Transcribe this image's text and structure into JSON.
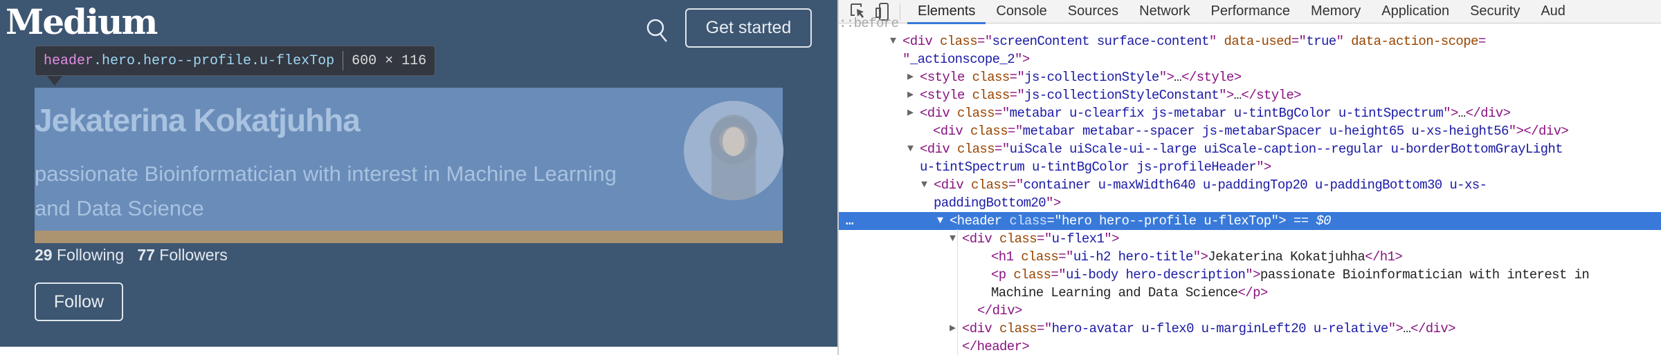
{
  "page": {
    "logo": "Medium",
    "get_started": "Get started",
    "tooltip": {
      "tag": "header",
      "classes": ".hero.hero--profile.u-flexTop",
      "size": "600 × 116"
    },
    "profile": {
      "name": "Jekaterina Kokatjuhha",
      "description": "passionate Bioinformatician with interest in Machine Learning and Data Science",
      "following_count": "29",
      "following_label": "Following",
      "followers_count": "77",
      "followers_label": "Followers",
      "follow_button": "Follow"
    }
  },
  "devtools": {
    "tabs": [
      "Elements",
      "Console",
      "Sources",
      "Network",
      "Performance",
      "Memory",
      "Application",
      "Security",
      "Aud"
    ],
    "active_tab": "Elements",
    "selected_suffix": " == $0",
    "rows": [
      {
        "indent": 0,
        "tokens": [
          [
            "p",
            "::before"
          ]
        ]
      },
      {
        "indent": 92,
        "tri": "▼",
        "tokens": [
          [
            "t",
            "<div "
          ],
          [
            "a",
            "class"
          ],
          [
            "t",
            "=\""
          ],
          [
            "v",
            "screenContent surface-content"
          ],
          [
            "t",
            "\" "
          ],
          [
            "a",
            "data-used"
          ],
          [
            "t",
            "=\""
          ],
          [
            "v",
            "true"
          ],
          [
            "t",
            "\" "
          ],
          [
            "a",
            "data-action-scope"
          ],
          [
            "t",
            "="
          ]
        ]
      },
      {
        "indent": 92,
        "tokens": [
          [
            "t",
            "\""
          ],
          [
            "v",
            "_actionscope_2"
          ],
          [
            "t",
            "\">"
          ]
        ]
      },
      {
        "indent": 117,
        "tri": "▶",
        "tokens": [
          [
            "t",
            "<style "
          ],
          [
            "a",
            "class"
          ],
          [
            "t",
            "=\""
          ],
          [
            "v",
            "js-collectionStyle"
          ],
          [
            "t",
            "\">"
          ],
          [
            "x",
            "…"
          ],
          [
            "t",
            "</style>"
          ]
        ]
      },
      {
        "indent": 117,
        "tri": "▶",
        "tokens": [
          [
            "t",
            "<style "
          ],
          [
            "a",
            "class"
          ],
          [
            "t",
            "=\""
          ],
          [
            "v",
            "js-collectionStyleConstant"
          ],
          [
            "t",
            "\">"
          ],
          [
            "x",
            "…"
          ],
          [
            "t",
            "</style>"
          ]
        ]
      },
      {
        "indent": 117,
        "tri": "▶",
        "tokens": [
          [
            "t",
            "<div "
          ],
          [
            "a",
            "class"
          ],
          [
            "t",
            "=\""
          ],
          [
            "v",
            "metabar u-clearfix js-metabar u-tintBgColor u-tintSpectrum"
          ],
          [
            "t",
            "\">"
          ],
          [
            "x",
            "…"
          ],
          [
            "t",
            "</div>"
          ]
        ]
      },
      {
        "indent": 136,
        "tokens": [
          [
            "t",
            "<div "
          ],
          [
            "a",
            "class"
          ],
          [
            "t",
            "=\""
          ],
          [
            "v",
            "metabar metabar--spacer js-metabarSpacer u-height65 u-xs-height56"
          ],
          [
            "t",
            "\"></div>"
          ]
        ]
      },
      {
        "indent": 117,
        "tri": "▼",
        "tokens": [
          [
            "t",
            "<div "
          ],
          [
            "a",
            "class"
          ],
          [
            "t",
            "=\""
          ],
          [
            "v",
            "uiScale uiScale-ui--large uiScale-caption--regular u-borderBottomGrayLight"
          ]
        ]
      },
      {
        "indent": 117,
        "tokens": [
          [
            "v",
            "u-tintSpectrum u-tintBgColor js-profileHeader"
          ],
          [
            "t",
            "\">"
          ]
        ]
      },
      {
        "indent": 137,
        "tri": "▼",
        "tokens": [
          [
            "t",
            "<div "
          ],
          [
            "a",
            "class"
          ],
          [
            "t",
            "=\""
          ],
          [
            "v",
            "container u-maxWidth640 u-paddingTop20 u-paddingBottom30 u-xs-"
          ]
        ]
      },
      {
        "indent": 137,
        "tokens": [
          [
            "v",
            "paddingBottom20"
          ],
          [
            "t",
            "\">"
          ]
        ]
      },
      {
        "indent": 160,
        "tri": "▼",
        "sel": true,
        "tokens": [
          [
            "t",
            "<header "
          ],
          [
            "a",
            "class"
          ],
          [
            "t",
            "=\""
          ],
          [
            "v",
            "hero hero--profile u-flexTop"
          ],
          [
            "t",
            "\">"
          ]
        ]
      },
      {
        "indent": 178,
        "tri": "▼",
        "tokens": [
          [
            "t",
            "<div "
          ],
          [
            "a",
            "class"
          ],
          [
            "t",
            "=\""
          ],
          [
            "v",
            "u-flex1"
          ],
          [
            "t",
            "\">"
          ]
        ]
      },
      {
        "indent": 220,
        "tokens": [
          [
            "t",
            "<h1 "
          ],
          [
            "a",
            "class"
          ],
          [
            "t",
            "=\""
          ],
          [
            "v",
            "ui-h2 hero-title"
          ],
          [
            "t",
            "\">"
          ],
          [
            "x",
            "Jekaterina Kokatjuhha"
          ],
          [
            "t",
            "</h1>"
          ]
        ]
      },
      {
        "indent": 220,
        "tokens": [
          [
            "t",
            "<p "
          ],
          [
            "a",
            "class"
          ],
          [
            "t",
            "=\""
          ],
          [
            "v",
            "ui-body hero-description"
          ],
          [
            "t",
            "\">"
          ],
          [
            "x",
            "passionate Bioinformatician with interest in"
          ]
        ]
      },
      {
        "indent": 220,
        "tokens": [
          [
            "x",
            "Machine Learning and Data Science"
          ],
          [
            "t",
            "</p>"
          ]
        ]
      },
      {
        "indent": 200,
        "tokens": [
          [
            "t",
            "</div>"
          ]
        ]
      },
      {
        "indent": 178,
        "tri": "▶",
        "tokens": [
          [
            "t",
            "<div "
          ],
          [
            "a",
            "class"
          ],
          [
            "t",
            "=\""
          ],
          [
            "v",
            "hero-avatar u-flex0 u-marginLeft20 u-relative"
          ],
          [
            "t",
            "\">"
          ],
          [
            "x",
            "…"
          ],
          [
            "t",
            "</div>"
          ]
        ]
      },
      {
        "indent": 178,
        "tokens": [
          [
            "t",
            "</header>"
          ]
        ]
      }
    ]
  },
  "colors": {
    "page_bg": "#3d5672",
    "highlight_content": "#6a8cb8",
    "highlight_margin": "#ad9470",
    "selection": "#3879d9"
  }
}
